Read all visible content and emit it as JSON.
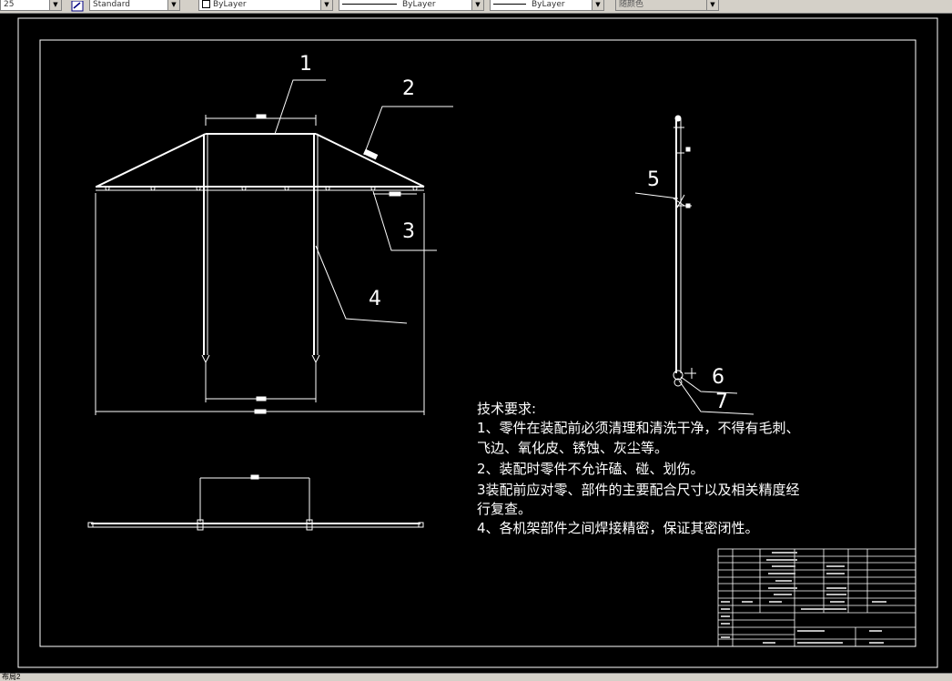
{
  "toolbar": {
    "scale_value": "25",
    "textstyle_value": "Standard",
    "layer_value": "ByLayer",
    "linetype_value": "ByLayer",
    "lineweight_value": "ByLayer",
    "color_value": "随颜色"
  },
  "drawing": {
    "balloons": [
      "1",
      "2",
      "3",
      "4",
      "5",
      "6",
      "7"
    ],
    "notes_title": "技术要求:",
    "notes": [
      "1、零件在装配前必须清理和清洗干净，不得有毛刺、",
      "飞边、氧化皮、锈蚀、灰尘等。",
      "2、装配时零件不允许磕、碰、划伤。",
      "3装配前应对零、部件的主要配合尺寸以及相关精度经",
      "行复查。",
      "4、各机架部件之间焊接精密，保证其密闭性。"
    ]
  },
  "status": {
    "layout_tab": "布局2"
  }
}
